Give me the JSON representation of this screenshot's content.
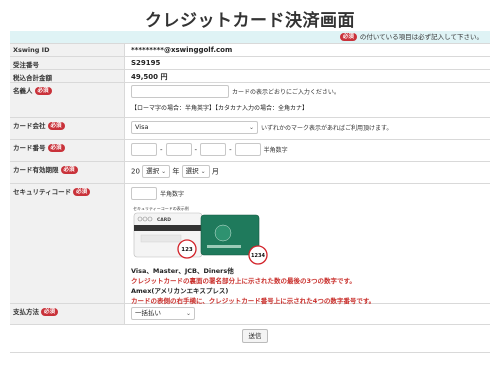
{
  "page": {
    "title": "クレジットカード決済画面"
  },
  "notice": {
    "required_badge": "必須",
    "text": "の付いている項目は必ず記入して下さい。"
  },
  "rows": {
    "xswing_id": {
      "label": "Xswing ID",
      "value": "*********@xswinggolf.com"
    },
    "order_no": {
      "label": "受注番号",
      "value": "S29195"
    },
    "total": {
      "label": "税込合計金額",
      "value": "49,500 円"
    },
    "name": {
      "label": "名義人",
      "badge": "必須",
      "hint": "カードの表示どおりにご入力ください。",
      "note": "【ローマ字の場合：半角英字】【カタカナ入力の場合：全角カナ】"
    },
    "company": {
      "label": "カード会社",
      "badge": "必須",
      "selected": "Visa",
      "hint": "いずれかのマーク表示があればご利用頂けます。"
    },
    "number": {
      "label": "カード番号",
      "badge": "必須",
      "sep": "-",
      "hint": "半角数字"
    },
    "expiry": {
      "label": "カード有効期限",
      "badge": "必須",
      "prefix": "20",
      "year_select": "選択",
      "year_unit": "年",
      "month_select": "選択",
      "month_unit": "月"
    },
    "security": {
      "label": "セキュリティコード",
      "badge": "必須",
      "hint": "半角数字",
      "image_caption": "セキュリティーコードの表示例",
      "card_label": "CARD",
      "code_front": "123",
      "code_amex": "1234",
      "brands": "Visa、Master、JCB、Diners他",
      "brands_desc": "クレジットカードの裏面の署名部分上に示された数の最後の3つの数字です。",
      "amex": "Amex(アメリカンエキスプレス)",
      "amex_desc": "カードの表側の右手横に、クレジットカード番号上に示された4つの数字番号です。"
    },
    "payment": {
      "label": "支払方法",
      "badge": "必須",
      "selected": "一括払い"
    }
  },
  "submit_label": "送信",
  "colors": {
    "accent": "#c9323a",
    "notice_bg": "#dff3f5",
    "label_bg": "#f1f1f1",
    "amex_green": "#1f7a5c"
  }
}
